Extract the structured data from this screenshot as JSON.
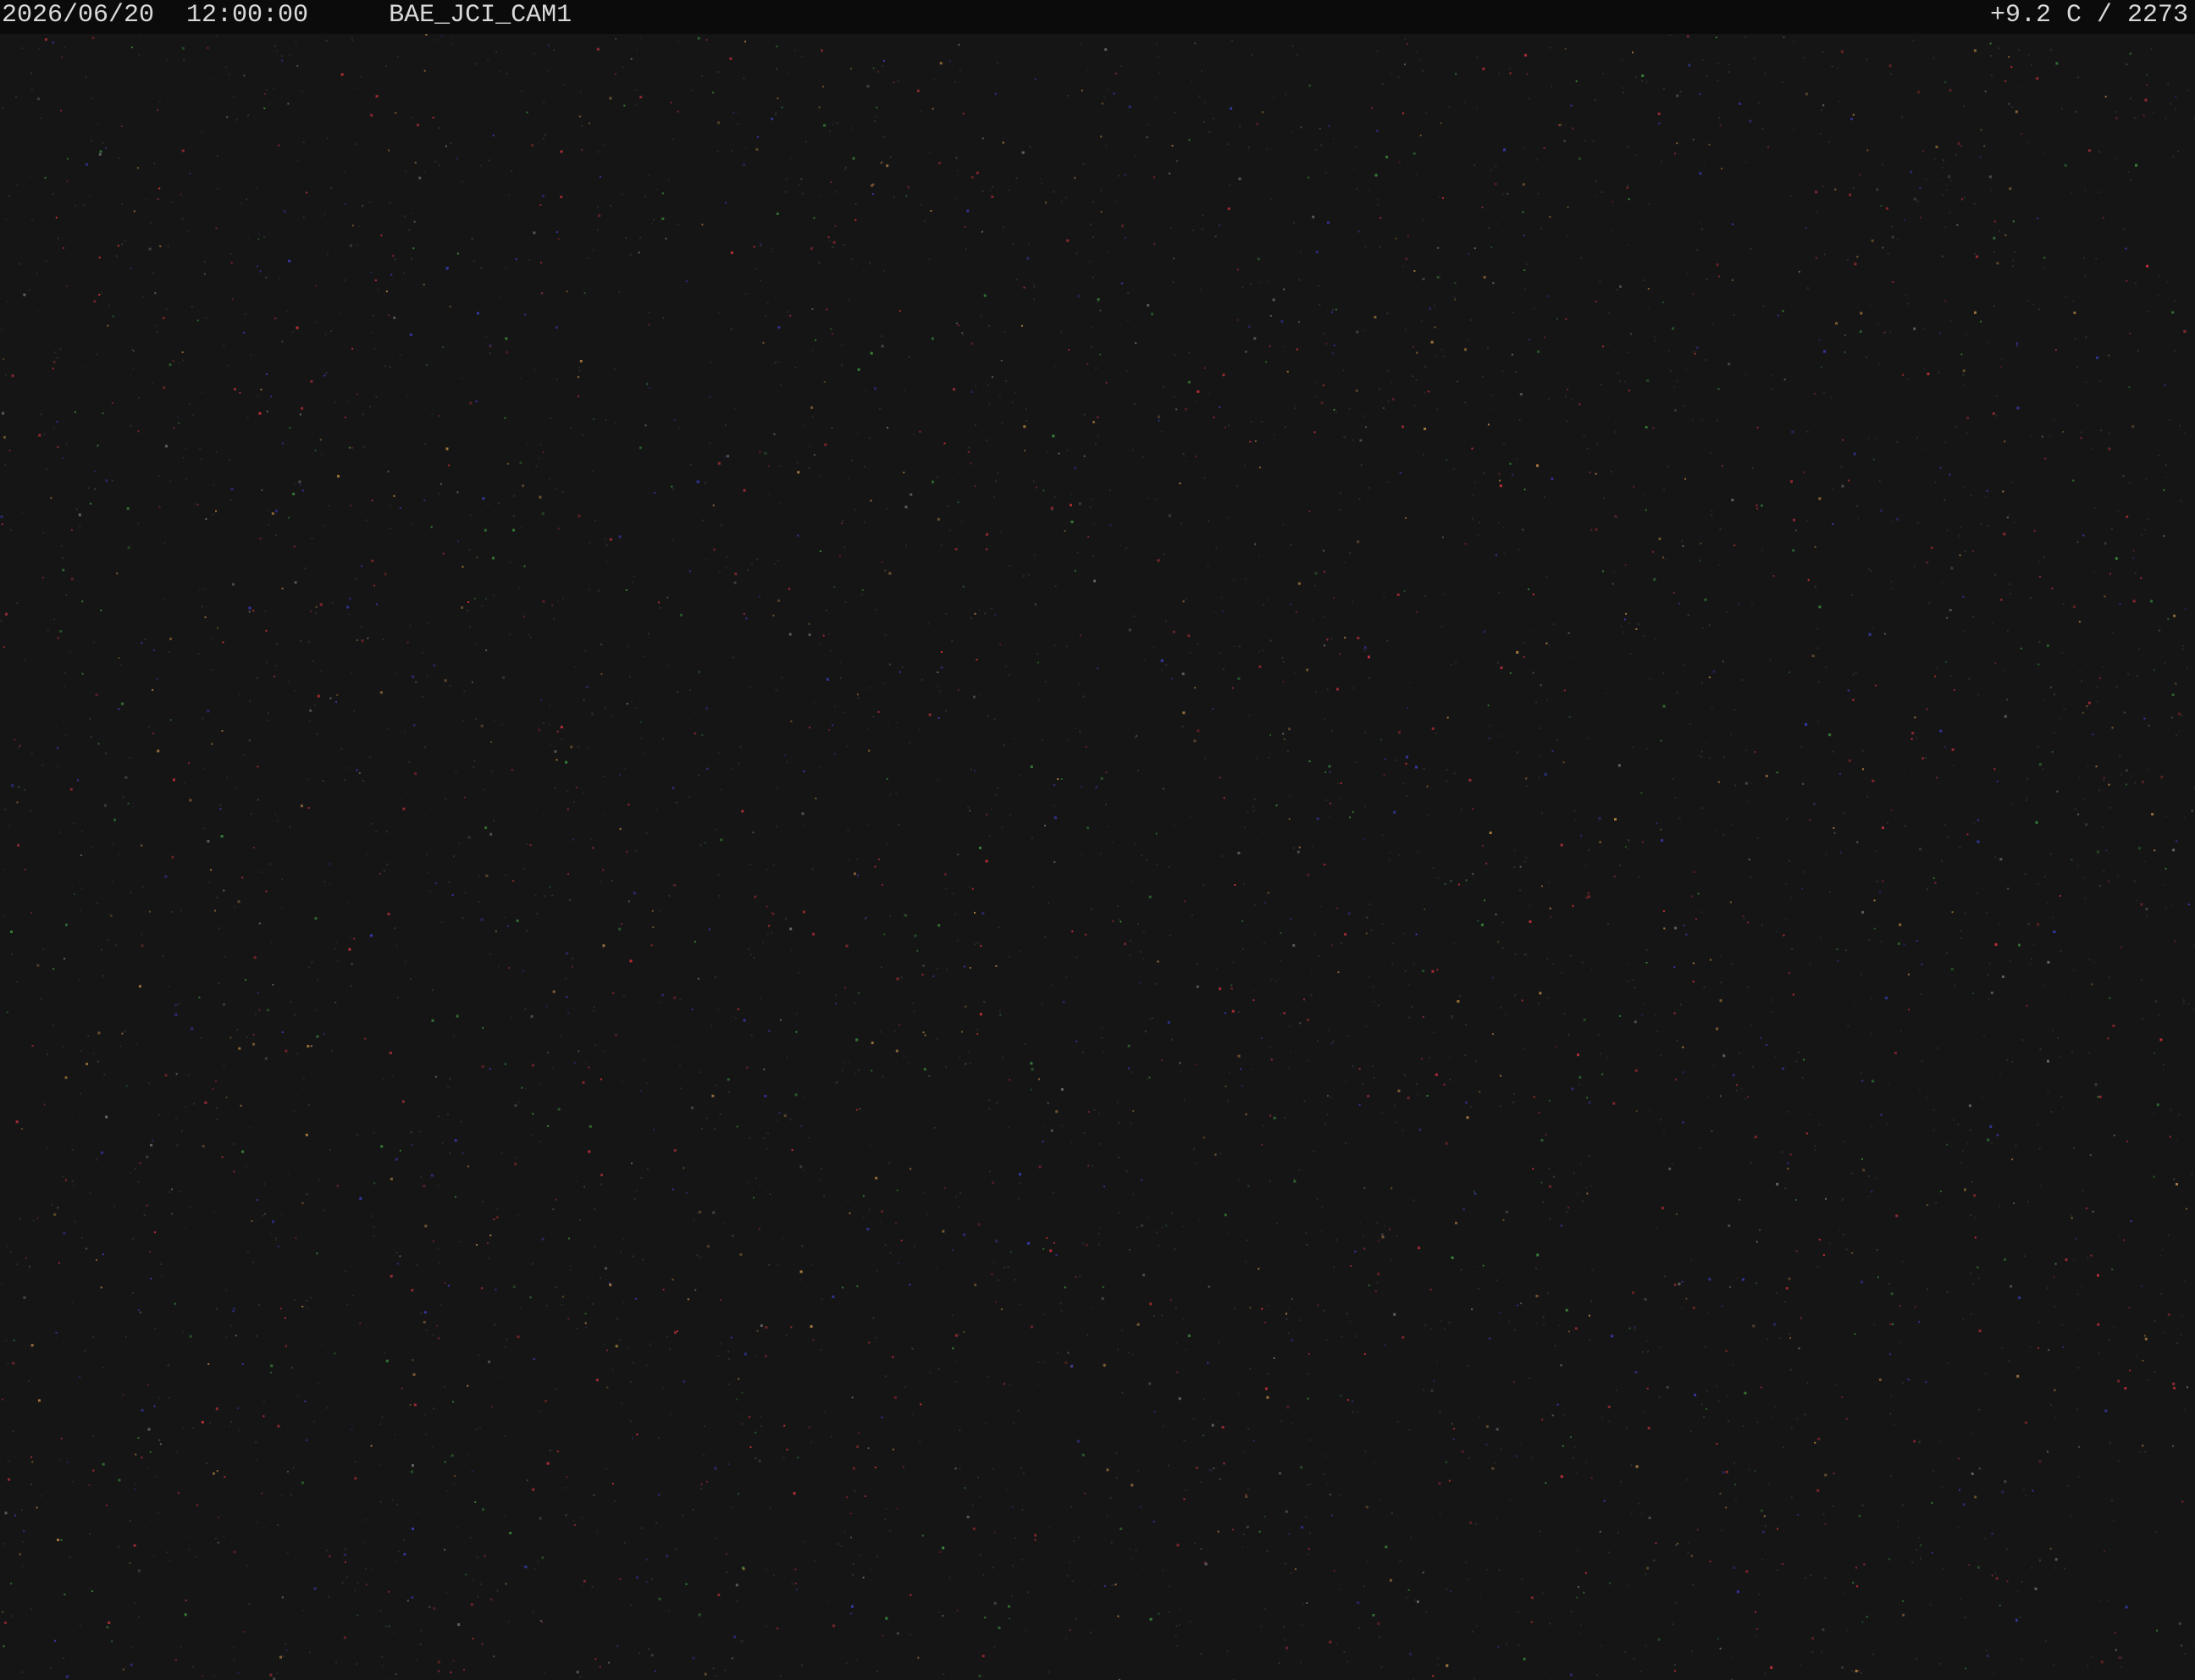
{
  "overlay": {
    "date": "2026/06/20",
    "time": "12:00:00",
    "camera_name": "BAE_JCI_CAM1",
    "temperature_altitude": "+9.2 C / 2273"
  },
  "scene": {
    "description_type": "night sky noise",
    "background_color": "#151516",
    "bar_color": "#0b0b0c",
    "text_color": "#d9d9d9",
    "speck_colors": [
      "#c8303a",
      "#9a2c34",
      "#3a8a3a",
      "#3a3ab0",
      "#6a6a6a",
      "#b08040"
    ]
  }
}
